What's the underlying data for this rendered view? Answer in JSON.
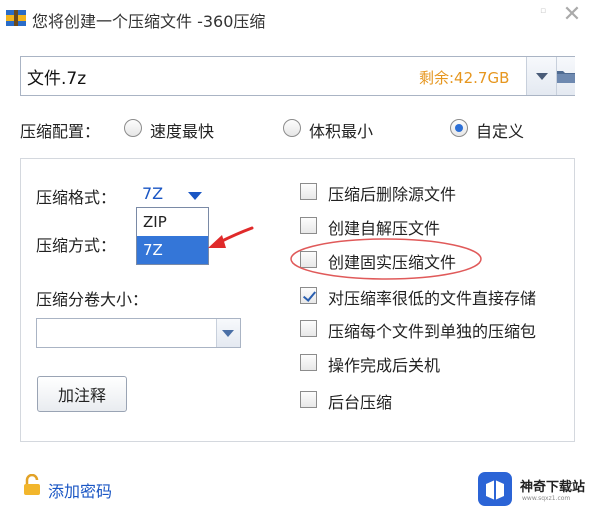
{
  "window": {
    "title": "您将创建一个压缩文件 -360压缩",
    "close_glyph": "✕",
    "minimize_glyph": "▫",
    "icon": "archive-app-icon"
  },
  "path": {
    "value": "文件.7z",
    "free_space": "剩余:42.7GB",
    "dropdown_icon": "chevron-down-icon",
    "browse_icon": "folder-icon"
  },
  "config": {
    "label": "压缩配置：",
    "options": [
      {
        "label": "速度最快",
        "checked": false
      },
      {
        "label": "体积最小",
        "checked": false
      },
      {
        "label": "自定义",
        "checked": true
      }
    ]
  },
  "settings": {
    "format_label": "压缩格式：",
    "format_value": "7Z",
    "format_options": [
      {
        "label": "ZIP",
        "selected": false
      },
      {
        "label": "7Z",
        "selected": true
      }
    ],
    "method_label": "压缩方式：",
    "volume_label": "压缩分卷大小：",
    "volume_value": "",
    "comment_button": "加注释"
  },
  "options": [
    {
      "label": "压缩后删除源文件",
      "checked": false
    },
    {
      "label": "创建自解压文件",
      "checked": false
    },
    {
      "label": "创建固实压缩文件",
      "checked": false
    },
    {
      "label": "对压缩率很低的文件直接存储",
      "checked": true
    },
    {
      "label": "压缩每个文件到单独的压缩包",
      "checked": false
    },
    {
      "label": "操作完成后关机",
      "checked": false
    },
    {
      "label": "后台压缩",
      "checked": false
    }
  ],
  "footer": {
    "password_link": "添加密码",
    "lock_icon": "lock-icon"
  },
  "watermark": {
    "name": "神奇下载站",
    "url": "www.sqxz1.com"
  },
  "colors": {
    "accent": "#1a56c4",
    "selected": "#3476d8",
    "free_space": "#e6961e",
    "annotation": "#e02a2a"
  }
}
